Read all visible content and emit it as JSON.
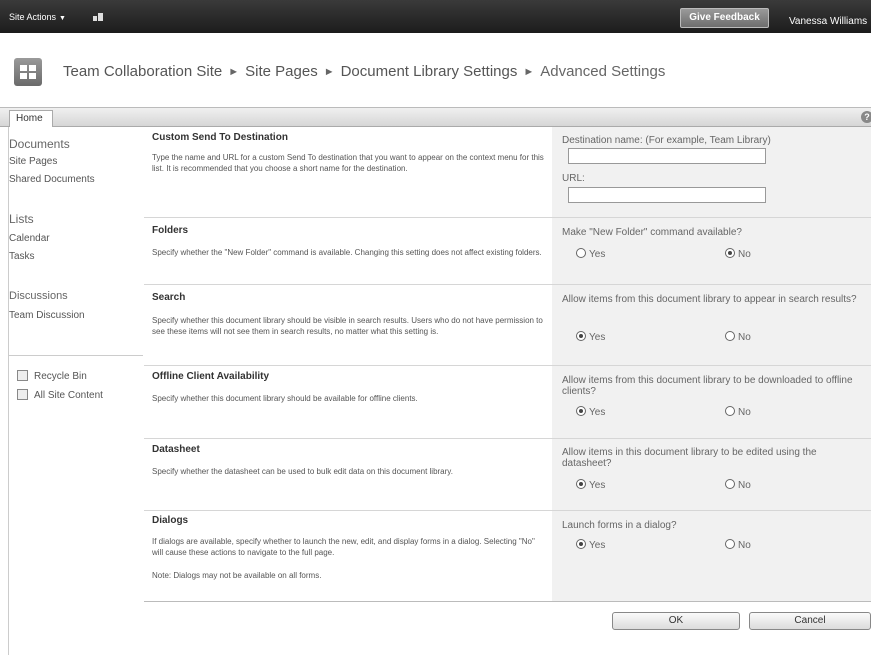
{
  "topbar": {
    "site_actions": "Site Actions",
    "feedback_label": "Give Feedback",
    "user_name": "Vanessa Williams"
  },
  "breadcrumb": [
    "Team Collaboration Site",
    "Site Pages",
    "Document Library Settings",
    "Advanced Settings"
  ],
  "tabs": {
    "home": "Home"
  },
  "quick_launch": {
    "documents_heading": "Documents",
    "documents": [
      "Site Pages",
      "Shared Documents"
    ],
    "lists_heading": "Lists",
    "lists": [
      "Calendar",
      "Tasks"
    ],
    "discussions_heading": "Discussions",
    "discussions": [
      "Team Discussion"
    ],
    "recycle_bin": "Recycle Bin",
    "all_site_content": "All Site Content"
  },
  "sections": {
    "send_to": {
      "title": "Custom Send To Destination",
      "desc": "Type the name and URL for a custom Send To destination that you want to appear on the context menu for this list. It is recommended that you choose a short name for the destination.",
      "name_label": "Destination name: (For example, Team Library)",
      "url_label": "URL:"
    },
    "folders": {
      "title": "Folders",
      "desc": "Specify whether the \"New Folder\" command is available. Changing this setting does not affect existing folders.",
      "question": "Make \"New Folder\" command available?",
      "yes": "Yes",
      "no": "No",
      "selected": "No"
    },
    "search": {
      "title": "Search",
      "desc": "Specify whether this document library should be visible in search results. Users who do not have permission to see these items will not see them in search results, no matter what this setting is.",
      "question": "Allow items from this document library to appear in search results?",
      "yes": "Yes",
      "no": "No",
      "selected": "Yes"
    },
    "offline": {
      "title": "Offline Client Availability",
      "desc": "Specify whether this document library should be available for offline clients.",
      "question": "Allow items from this document library to be downloaded to offline clients?",
      "yes": "Yes",
      "no": "No",
      "selected": "Yes"
    },
    "datasheet": {
      "title": "Datasheet",
      "desc": "Specify whether the datasheet can be used to bulk edit data on this document library.",
      "question": "Allow items in this document library to be edited using the datasheet?",
      "yes": "Yes",
      "no": "No",
      "selected": "Yes"
    },
    "dialogs": {
      "title": "Dialogs",
      "desc": "If dialogs are available, specify whether to launch the new, edit, and display forms in a dialog. Selecting \"No\" will cause these actions to navigate to the full page.",
      "note": "Note: Dialogs may not be available on all forms.",
      "question": "Launch forms in a dialog?",
      "yes": "Yes",
      "no": "No",
      "selected": "Yes"
    }
  },
  "buttons": {
    "ok": "OK",
    "cancel": "Cancel"
  }
}
